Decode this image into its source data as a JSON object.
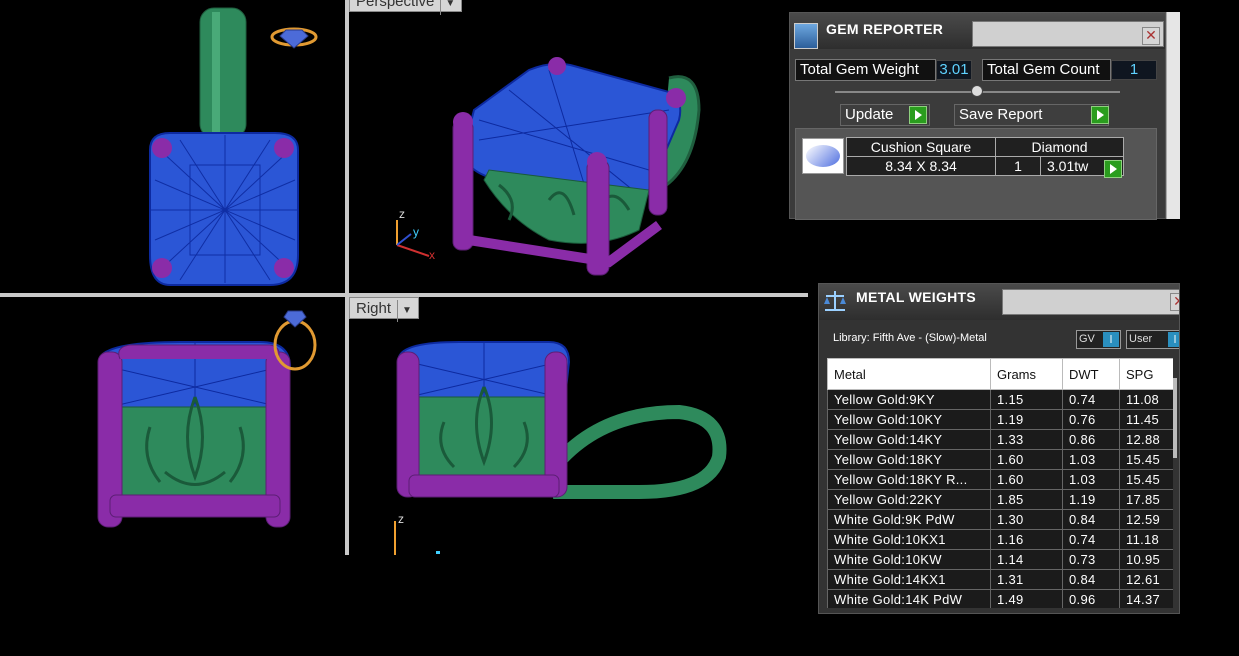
{
  "viewports": {
    "perspective_tab": "Perspective",
    "right_tab": "Right",
    "axes": {
      "z": "z",
      "y": "y",
      "x": "x"
    }
  },
  "gem_reporter": {
    "title": "GEM REPORTER",
    "total_weight_label": "Total Gem Weight",
    "total_weight_value": "3.01",
    "total_count_label": "Total Gem Count",
    "total_count_value": "1",
    "update_label": "Update",
    "save_report_label": "Save Report",
    "gem": {
      "cut": "Cushion Square",
      "type": "Diamond",
      "size": "8.34 X 8.34",
      "count": "1",
      "weight": "3.01tw"
    }
  },
  "metal_weights": {
    "title": "METAL WEIGHTS",
    "library": "Library: Fifth Ave - (Slow)-Metal",
    "gv_label": "GV",
    "user_label": "User",
    "columns": [
      "Metal",
      "Grams",
      "DWT",
      "SPG"
    ],
    "rows": [
      [
        "Yellow Gold:9KY",
        "1.15",
        "0.74",
        "11.08"
      ],
      [
        "Yellow Gold:10KY",
        "1.19",
        "0.76",
        "11.45"
      ],
      [
        "Yellow Gold:14KY",
        "1.33",
        "0.86",
        "12.88"
      ],
      [
        "Yellow Gold:18KY",
        "1.60",
        "1.03",
        "15.45"
      ],
      [
        "Yellow Gold:18KY R...",
        "1.60",
        "1.03",
        "15.45"
      ],
      [
        "Yellow Gold:22KY",
        "1.85",
        "1.19",
        "17.85"
      ],
      [
        "White Gold:9K PdW",
        "1.30",
        "0.84",
        "12.59"
      ],
      [
        "White Gold:10KX1",
        "1.16",
        "0.74",
        "11.18"
      ],
      [
        "White Gold:10KW",
        "1.14",
        "0.73",
        "10.95"
      ],
      [
        "White Gold:14KX1",
        "1.31",
        "0.84",
        "12.61"
      ],
      [
        "White Gold:14K PdW",
        "1.49",
        "0.96",
        "14.37"
      ]
    ]
  }
}
